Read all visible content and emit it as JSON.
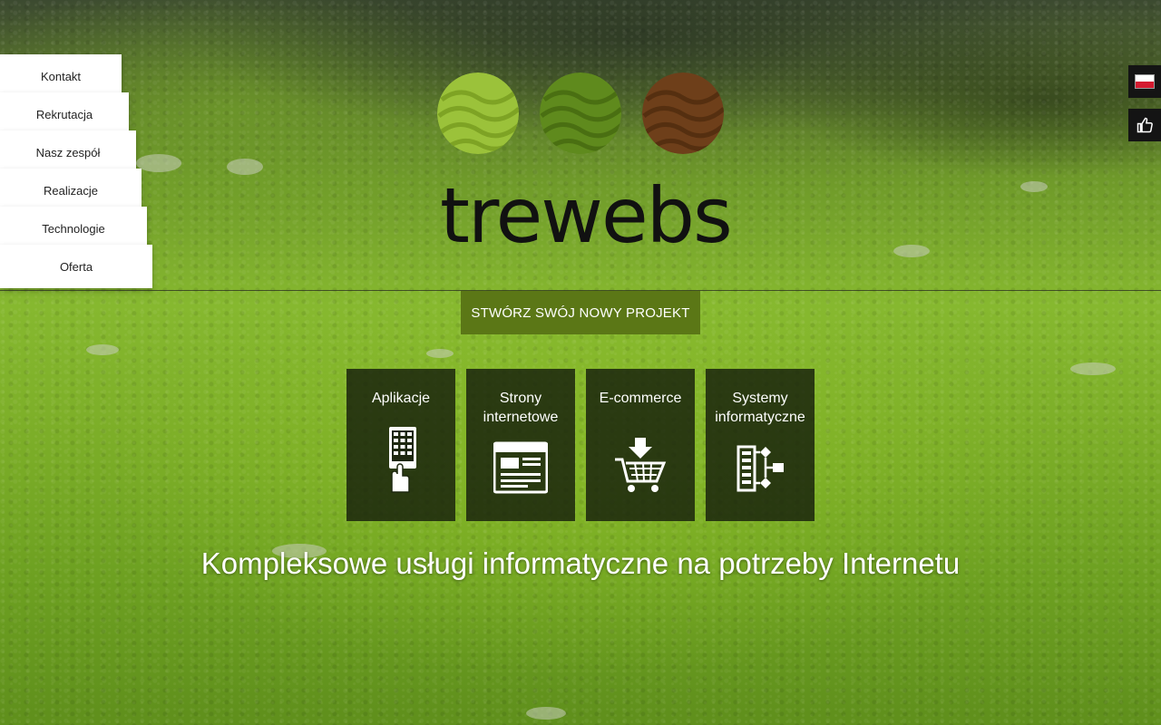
{
  "menu": {
    "items": [
      {
        "label": "Kontakt"
      },
      {
        "label": "Rekrutacja"
      },
      {
        "label": "Nasz zespół"
      },
      {
        "label": "Realizacje"
      },
      {
        "label": "Technologie"
      },
      {
        "label": "Oferta"
      }
    ]
  },
  "side_buttons": [
    {
      "icon": "polish-flag-icon"
    },
    {
      "icon": "thumbs-up-icon"
    }
  ],
  "logo": {
    "text": "trewebs",
    "circle_colors": [
      "#9bc23a",
      "#5f8a1d",
      "#6e3f1a"
    ]
  },
  "cta": {
    "label": "STWÓRZ SWÓJ NOWY PROJEKT"
  },
  "services": [
    {
      "label": "Aplikacje",
      "icon": "mobile-app-icon"
    },
    {
      "label": "Strony\ninternetowe",
      "icon": "website-icon"
    },
    {
      "label": "E-commerce",
      "icon": "shopping-cart-icon"
    },
    {
      "label": "Systemy\ninformatyczne",
      "icon": "flowchart-icon"
    }
  ],
  "tagline": "Kompleksowe usługi informatyczne na potrzeby Internetu",
  "colors": {
    "cta_background": "#5b7716",
    "tile_background": "#161e0c",
    "menu_background": "#ffffff"
  }
}
